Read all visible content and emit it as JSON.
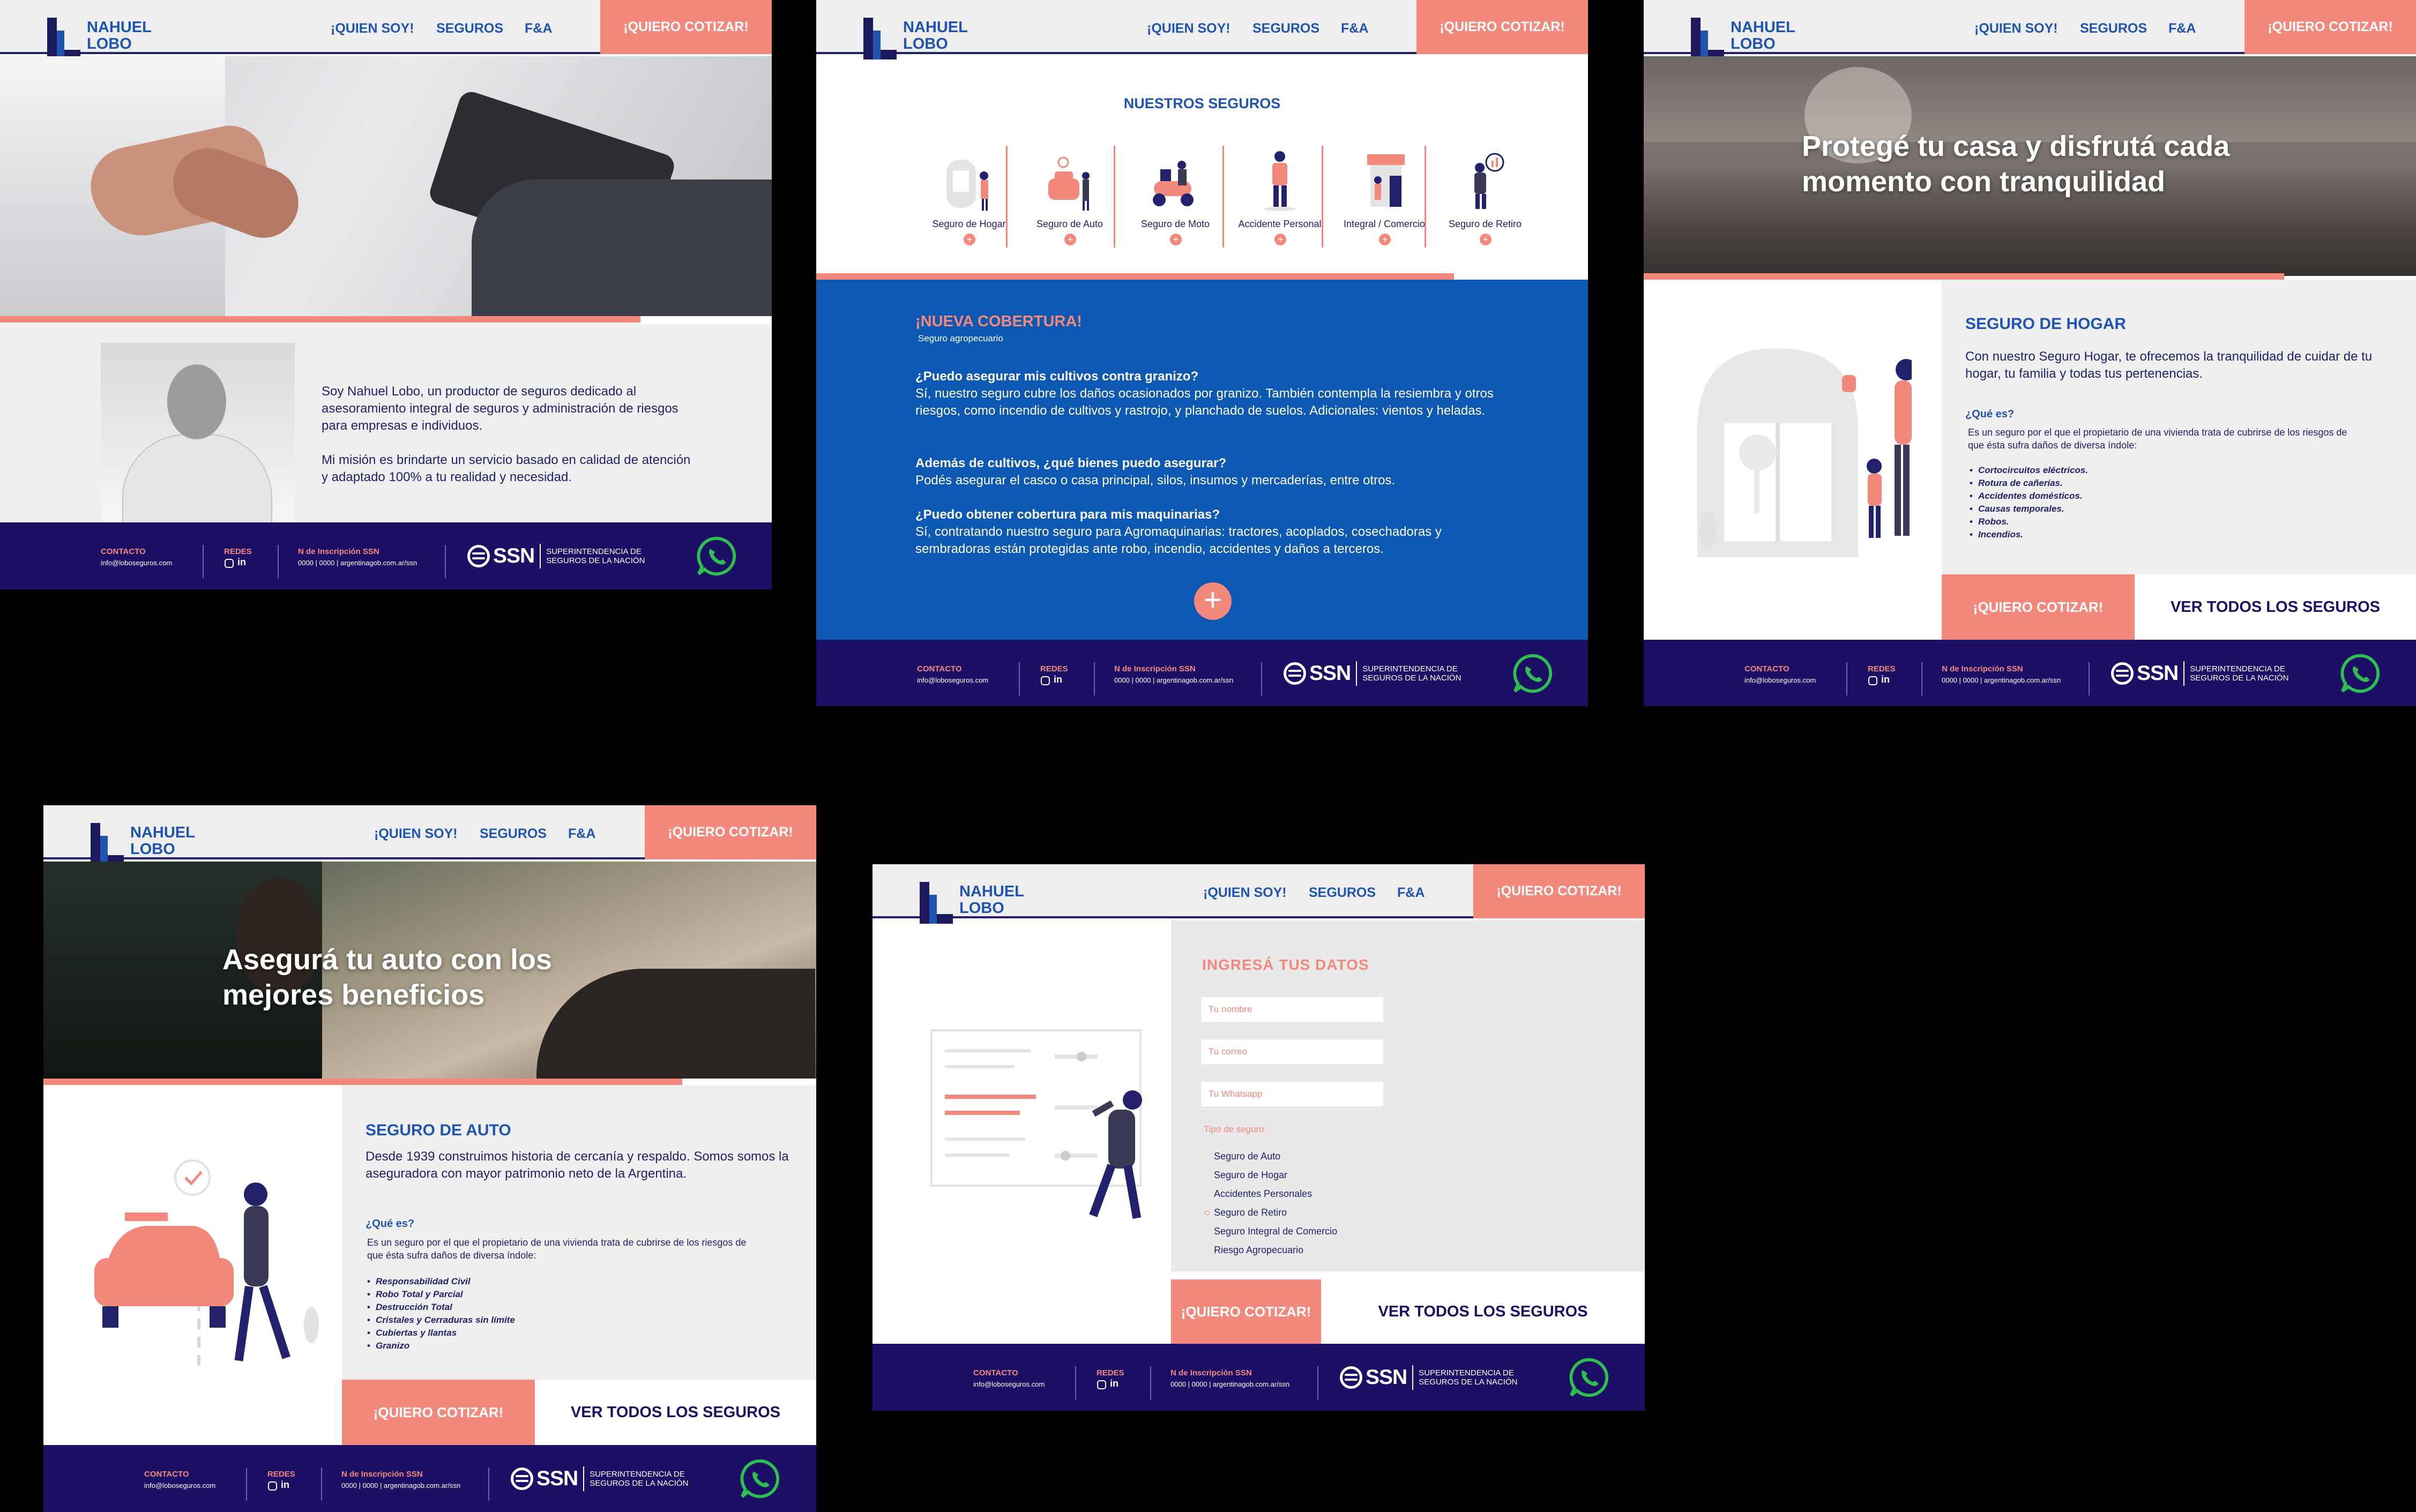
{
  "brand": {
    "line1": "NAHUEL",
    "line2": "LOBO"
  },
  "nav": {
    "quien": "¡QUIEN SOY!",
    "seguros": "SEGUROS",
    "fa": "F&A",
    "cta": "¡QUIERO COTIZAR!"
  },
  "footer": {
    "contact_label": "CONTACTO",
    "contact_email": "info@loboseguros.com",
    "redes_label": "REDES",
    "redes_icons": [
      "instagram-icon",
      "linkedin-icon"
    ],
    "ssn_label": "N de Inscripción SSN",
    "ssn_value": "0000 | 0000 | argentinagob.com.ar/ssn",
    "ssn_logo": "SSN",
    "ssn_sub1": "SUPERINTENDENCIA DE",
    "ssn_sub2": "SEGUROS DE LA NACIÓN"
  },
  "about": {
    "p1": "Soy Nahuel Lobo, un productor de seguros dedicado al asesoramiento integral de seguros y administración de riesgos para empresas e individuos.",
    "p2": "Mi misión es brindarte un servicio basado en calidad de atención y  adaptado 100% a tu realidad y necesidad."
  },
  "seguros": {
    "title": "NUESTROS SEGUROS",
    "items": [
      "Seguro de Hogar",
      "Seguro de Auto",
      "Seguro de Moto",
      "Accidente Personal",
      "Integral / Comercio",
      "Seguro de Retiro"
    ],
    "plus": "+"
  },
  "cobertura": {
    "title": "¡NUEVA COBERTURA!",
    "subtitle": "Seguro agropecuario",
    "q1": "¿Puedo asegurar mis cultivos contra granizo?",
    "a1": "Sí, nuestro seguro cubre los daños ocasionados por granizo. También contempla la resiembra y otros riesgos, como incendio de cultivos y rastrojo, y planchado de suelos. Adicionales: vientos y heladas.",
    "q2": "Además de cultivos, ¿qué bienes puedo asegurar?",
    "a2": "Podés asegurar el casco o casa principal, silos, insumos y mercaderías, entre otros.",
    "q3": "¿Puedo obtener cobertura para mis maquinarias?",
    "a3": "Sí, contratando nuestro seguro para Agromaquinarias: tractores, acoplados, cosechadoras y sembradoras están protegidas ante robo, incendio, accidentes y daños a terceros.",
    "plus": "+"
  },
  "hogar": {
    "hero": "Protegé tu casa y disfrutá cada momento con tranquilidad",
    "title": "SEGURO DE HOGAR",
    "desc": "Con nuestro Seguro Hogar, te ofrecemos la tranquilidad de cuidar de tu hogar, tu familia y todas tus pertenencias.",
    "que_label": "¿Qué es?",
    "que_desc": "Es un seguro por el que el propietario de una vivienda trata de cubrirse de los riesgos de que ésta sufra daños de diversa índole:",
    "list": [
      "Cortocircuitos eléctricos.",
      "Rotura de cañerías.",
      "Accidentes domésticos.",
      "Causas temporales.",
      "Robos.",
      "Incendios."
    ],
    "cta": "¡QUIERO COTIZAR!",
    "all": "VER TODOS LOS SEGUROS"
  },
  "auto": {
    "hero": "Asegurá tu auto con los mejores beneficios",
    "title": "SEGURO DE AUTO",
    "desc": "Desde 1939 construimos historia de cercanía y respaldo. Somos somos la aseguradora con mayor patrimonio neto de la Argentina.",
    "que_label": "¿Qué es?",
    "que_desc": "Es un seguro por el que el propietario de una vivienda trata de cubrirse de los riesgos de que ésta sufra daños de diversa índole:",
    "list": [
      "Responsabilidad Civil",
      "Robo Total y Parcial",
      "Destrucción Total",
      "Cristales y Cerraduras sin límite",
      "Cubiertas y llantas",
      "Granizo"
    ],
    "cta": "¡QUIERO COTIZAR!",
    "all": "VER TODOS LOS SEGUROS"
  },
  "form": {
    "title": "INGRESÁ  TUS DATOS",
    "name_ph": "Tu nombre",
    "email_ph": "Tu correo",
    "wa_ph": "Tu Whatsapp",
    "tipo_label": "Tipo de seguro:",
    "options": [
      "Seguro de Auto",
      "Seguro de Hogar",
      "Accidentes Personales",
      "Seguro de Retiro",
      "Seguro Integral de Comercio",
      "Riesgo Agropecuario"
    ],
    "cta": "¡QUIERO COTIZAR!",
    "all": "VER TODOS LOS SEGUROS"
  },
  "colors": {
    "navy": "#1b0f66",
    "blue": "#1f55b0",
    "coral": "#f3887c",
    "gray": "#efeff0",
    "whatsapp": "#2fbe4f"
  }
}
